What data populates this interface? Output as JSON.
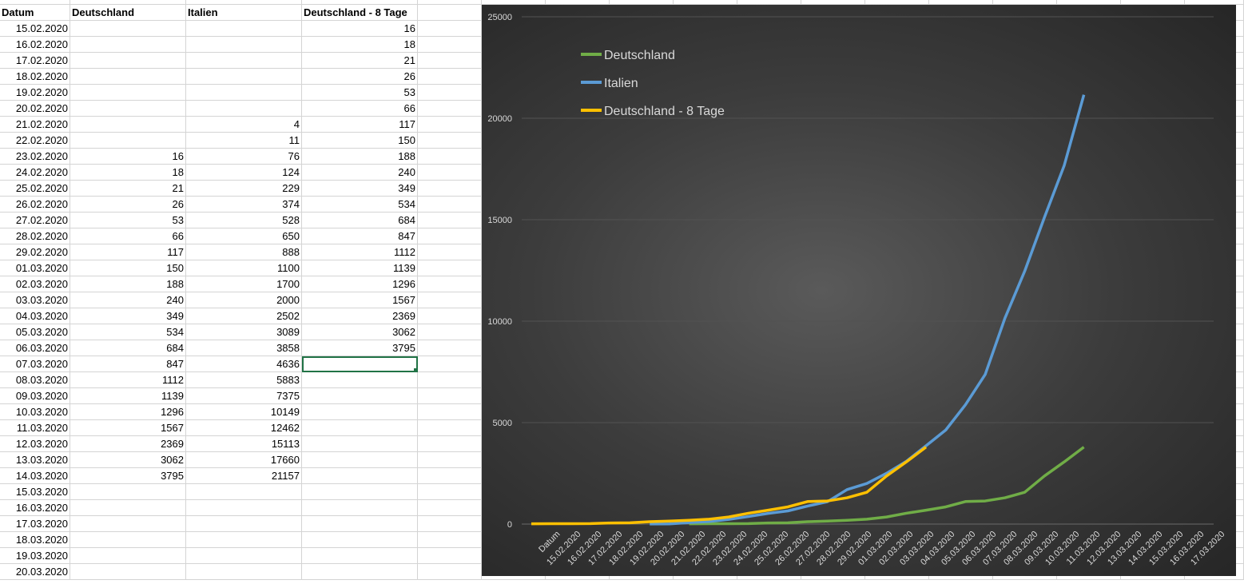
{
  "sheet": {
    "headers": [
      "Datum",
      "Deutschland",
      "Italien",
      "Deutschland - 8 Tage"
    ],
    "rows": [
      [
        "15.02.2020",
        "",
        "",
        "16"
      ],
      [
        "16.02.2020",
        "",
        "",
        "18"
      ],
      [
        "17.02.2020",
        "",
        "",
        "21"
      ],
      [
        "18.02.2020",
        "",
        "",
        "26"
      ],
      [
        "19.02.2020",
        "",
        "",
        "53"
      ],
      [
        "20.02.2020",
        "",
        "",
        "66"
      ],
      [
        "21.02.2020",
        "",
        "4",
        "117"
      ],
      [
        "22.02.2020",
        "",
        "11",
        "150"
      ],
      [
        "23.02.2020",
        "16",
        "76",
        "188"
      ],
      [
        "24.02.2020",
        "18",
        "124",
        "240"
      ],
      [
        "25.02.2020",
        "21",
        "229",
        "349"
      ],
      [
        "26.02.2020",
        "26",
        "374",
        "534"
      ],
      [
        "27.02.2020",
        "53",
        "528",
        "684"
      ],
      [
        "28.02.2020",
        "66",
        "650",
        "847"
      ],
      [
        "29.02.2020",
        "117",
        "888",
        "1112"
      ],
      [
        "01.03.2020",
        "150",
        "1100",
        "1139"
      ],
      [
        "02.03.2020",
        "188",
        "1700",
        "1296"
      ],
      [
        "03.03.2020",
        "240",
        "2000",
        "1567"
      ],
      [
        "04.03.2020",
        "349",
        "2502",
        "2369"
      ],
      [
        "05.03.2020",
        "534",
        "3089",
        "3062"
      ],
      [
        "06.03.2020",
        "684",
        "3858",
        "3795"
      ],
      [
        "07.03.2020",
        "847",
        "4636",
        ""
      ],
      [
        "08.03.2020",
        "1112",
        "5883",
        ""
      ],
      [
        "09.03.2020",
        "1139",
        "7375",
        ""
      ],
      [
        "10.03.2020",
        "1296",
        "10149",
        ""
      ],
      [
        "11.03.2020",
        "1567",
        "12462",
        ""
      ],
      [
        "12.03.2020",
        "2369",
        "15113",
        ""
      ],
      [
        "13.03.2020",
        "3062",
        "17660",
        ""
      ],
      [
        "14.03.2020",
        "3795",
        "21157",
        ""
      ],
      [
        "15.03.2020",
        "",
        "",
        ""
      ],
      [
        "16.03.2020",
        "",
        "",
        ""
      ],
      [
        "17.03.2020",
        "",
        "",
        ""
      ],
      [
        "18.03.2020",
        "",
        "",
        ""
      ],
      [
        "19.03.2020",
        "",
        "",
        ""
      ],
      [
        "20.03.2020",
        "",
        "",
        ""
      ]
    ],
    "selected_cell": {
      "row": 21,
      "col": 3
    }
  },
  "chart_data": {
    "type": "line",
    "title": "",
    "xlabel": "",
    "ylabel": "",
    "ylim": [
      0,
      25000
    ],
    "yticks": [
      "0",
      "5000",
      "10000",
      "15000",
      "20000",
      "25000"
    ],
    "categories": [
      "Datum",
      "15.02.2020",
      "16.02.2020",
      "17.02.2020",
      "18.02.2020",
      "19.02.2020",
      "20.02.2020",
      "21.02.2020",
      "22.02.2020",
      "23.02.2020",
      "24.02.2020",
      "25.02.2020",
      "26.02.2020",
      "27.02.2020",
      "28.02.2020",
      "29.02.2020",
      "01.03.2020",
      "02.03.2020",
      "03.03.2020",
      "04.03.2020",
      "05.03.2020",
      "06.03.2020",
      "07.03.2020",
      "08.03.2020",
      "09.03.2020",
      "10.03.2020",
      "11.03.2020",
      "12.03.2020",
      "13.03.2020",
      "14.03.2020",
      "15.03.2020",
      "16.03.2020",
      "17.03.2020"
    ],
    "legend_position": "top-left",
    "grid": true,
    "series": [
      {
        "name": "Deutschland",
        "color": "#70ad47",
        "values": [
          null,
          null,
          null,
          null,
          null,
          null,
          null,
          null,
          16,
          18,
          21,
          26,
          53,
          66,
          117,
          150,
          188,
          240,
          349,
          534,
          684,
          847,
          1112,
          1139,
          1296,
          1567,
          2369,
          3062,
          3795
        ]
      },
      {
        "name": "Italien",
        "color": "#5b9bd5",
        "values": [
          null,
          null,
          null,
          null,
          null,
          null,
          4,
          11,
          76,
          124,
          229,
          374,
          528,
          650,
          888,
          1100,
          1700,
          2000,
          2502,
          3089,
          3858,
          4636,
          5883,
          7375,
          10149,
          12462,
          15113,
          17660,
          21157
        ]
      },
      {
        "name": "Deutschland - 8 Tage",
        "color": "#ffc000",
        "values": [
          16,
          18,
          21,
          26,
          53,
          66,
          117,
          150,
          188,
          240,
          349,
          534,
          684,
          847,
          1112,
          1139,
          1296,
          1567,
          2369,
          3062,
          3795
        ]
      }
    ]
  }
}
